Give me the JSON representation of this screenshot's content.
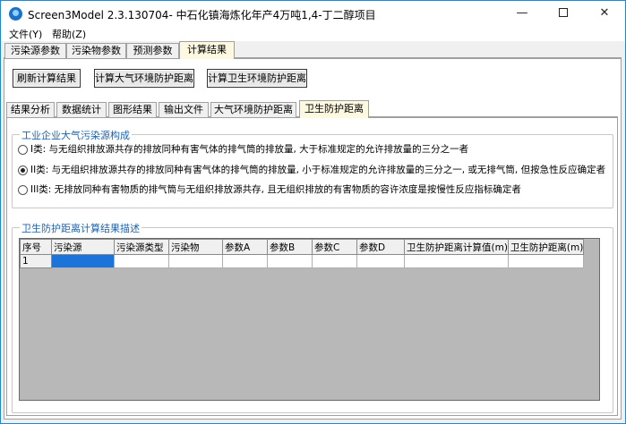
{
  "window": {
    "title": "Screen3Model 2.3.130704- 中石化镇海炼化年产4万吨1,4-丁二醇项目",
    "controls": {
      "minimize": "—",
      "close": "✕"
    }
  },
  "menu": [
    {
      "label": "文件(Y)"
    },
    {
      "label": "帮助(Z)"
    }
  ],
  "main_tabs": [
    {
      "label": "污染源参数"
    },
    {
      "label": "污染物参数"
    },
    {
      "label": "预测参数"
    },
    {
      "label": "计算结果",
      "active": true
    }
  ],
  "toolbar": {
    "refresh": "刷新计算结果",
    "atmos_distance": "计算大气环境防护距离",
    "health_distance": "计算卫生环境防护距离"
  },
  "sub_tabs": [
    {
      "label": "结果分析"
    },
    {
      "label": "数据统计"
    },
    {
      "label": "图形结果"
    },
    {
      "label": "输出文件"
    },
    {
      "label": "大气环境防护距离"
    },
    {
      "label": "卫生防护距离",
      "active": true
    }
  ],
  "source_group": {
    "title": "工业企业大气污染源构成",
    "options": [
      {
        "label": "I类: 与无组织排放源共存的排放同种有害气体的排气筒的排放量, 大于标准规定的允许排放量的三分之一者",
        "checked": false
      },
      {
        "label": "II类: 与无组织排放源共存的排放同种有害气体的排气筒的排放量, 小于标准规定的允许排放量的三分之一, 或无排气筒, 但按急性反应确定者",
        "checked": true
      },
      {
        "label": "III类: 无排放同种有害物质的排气筒与无组织排放源共存, 且无组织排放的有害物质的容许浓度是按慢性反应指标确定者",
        "checked": false
      }
    ]
  },
  "result_group": {
    "title": "卫生防护距离计算结果描述",
    "columns": [
      "序号",
      "污染源",
      "污染源类型",
      "污染物",
      "参数A",
      "参数B",
      "参数C",
      "参数D",
      "卫生防护距离计算值(m)",
      "卫生防护距离(m)"
    ],
    "rows": [
      [
        "1",
        "",
        "",
        "",
        "",
        "",
        "",
        "",
        "",
        ""
      ]
    ]
  }
}
